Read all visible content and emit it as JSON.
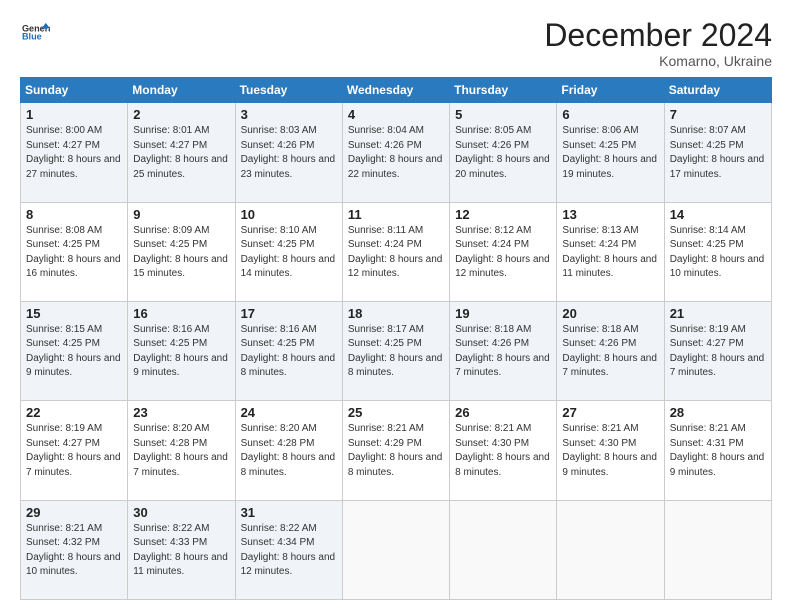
{
  "logo": {
    "line1": "General",
    "line2": "Blue"
  },
  "title": "December 2024",
  "location": "Komarno, Ukraine",
  "days_of_week": [
    "Sunday",
    "Monday",
    "Tuesday",
    "Wednesday",
    "Thursday",
    "Friday",
    "Saturday"
  ],
  "weeks": [
    [
      {
        "day": 1,
        "sunrise": "8:00 AM",
        "sunset": "4:27 PM",
        "daylight": "8 hours and 27 minutes."
      },
      {
        "day": 2,
        "sunrise": "8:01 AM",
        "sunset": "4:27 PM",
        "daylight": "8 hours and 25 minutes."
      },
      {
        "day": 3,
        "sunrise": "8:03 AM",
        "sunset": "4:26 PM",
        "daylight": "8 hours and 23 minutes."
      },
      {
        "day": 4,
        "sunrise": "8:04 AM",
        "sunset": "4:26 PM",
        "daylight": "8 hours and 22 minutes."
      },
      {
        "day": 5,
        "sunrise": "8:05 AM",
        "sunset": "4:26 PM",
        "daylight": "8 hours and 20 minutes."
      },
      {
        "day": 6,
        "sunrise": "8:06 AM",
        "sunset": "4:25 PM",
        "daylight": "8 hours and 19 minutes."
      },
      {
        "day": 7,
        "sunrise": "8:07 AM",
        "sunset": "4:25 PM",
        "daylight": "8 hours and 17 minutes."
      }
    ],
    [
      {
        "day": 8,
        "sunrise": "8:08 AM",
        "sunset": "4:25 PM",
        "daylight": "8 hours and 16 minutes."
      },
      {
        "day": 9,
        "sunrise": "8:09 AM",
        "sunset": "4:25 PM",
        "daylight": "8 hours and 15 minutes."
      },
      {
        "day": 10,
        "sunrise": "8:10 AM",
        "sunset": "4:25 PM",
        "daylight": "8 hours and 14 minutes."
      },
      {
        "day": 11,
        "sunrise": "8:11 AM",
        "sunset": "4:24 PM",
        "daylight": "8 hours and 12 minutes."
      },
      {
        "day": 12,
        "sunrise": "8:12 AM",
        "sunset": "4:24 PM",
        "daylight": "8 hours and 12 minutes."
      },
      {
        "day": 13,
        "sunrise": "8:13 AM",
        "sunset": "4:24 PM",
        "daylight": "8 hours and 11 minutes."
      },
      {
        "day": 14,
        "sunrise": "8:14 AM",
        "sunset": "4:25 PM",
        "daylight": "8 hours and 10 minutes."
      }
    ],
    [
      {
        "day": 15,
        "sunrise": "8:15 AM",
        "sunset": "4:25 PM",
        "daylight": "8 hours and 9 minutes."
      },
      {
        "day": 16,
        "sunrise": "8:16 AM",
        "sunset": "4:25 PM",
        "daylight": "8 hours and 9 minutes."
      },
      {
        "day": 17,
        "sunrise": "8:16 AM",
        "sunset": "4:25 PM",
        "daylight": "8 hours and 8 minutes."
      },
      {
        "day": 18,
        "sunrise": "8:17 AM",
        "sunset": "4:25 PM",
        "daylight": "8 hours and 8 minutes."
      },
      {
        "day": 19,
        "sunrise": "8:18 AM",
        "sunset": "4:26 PM",
        "daylight": "8 hours and 7 minutes."
      },
      {
        "day": 20,
        "sunrise": "8:18 AM",
        "sunset": "4:26 PM",
        "daylight": "8 hours and 7 minutes."
      },
      {
        "day": 21,
        "sunrise": "8:19 AM",
        "sunset": "4:27 PM",
        "daylight": "8 hours and 7 minutes."
      }
    ],
    [
      {
        "day": 22,
        "sunrise": "8:19 AM",
        "sunset": "4:27 PM",
        "daylight": "8 hours and 7 minutes."
      },
      {
        "day": 23,
        "sunrise": "8:20 AM",
        "sunset": "4:28 PM",
        "daylight": "8 hours and 7 minutes."
      },
      {
        "day": 24,
        "sunrise": "8:20 AM",
        "sunset": "4:28 PM",
        "daylight": "8 hours and 8 minutes."
      },
      {
        "day": 25,
        "sunrise": "8:21 AM",
        "sunset": "4:29 PM",
        "daylight": "8 hours and 8 minutes."
      },
      {
        "day": 26,
        "sunrise": "8:21 AM",
        "sunset": "4:30 PM",
        "daylight": "8 hours and 8 minutes."
      },
      {
        "day": 27,
        "sunrise": "8:21 AM",
        "sunset": "4:30 PM",
        "daylight": "8 hours and 9 minutes."
      },
      {
        "day": 28,
        "sunrise": "8:21 AM",
        "sunset": "4:31 PM",
        "daylight": "8 hours and 9 minutes."
      }
    ],
    [
      {
        "day": 29,
        "sunrise": "8:21 AM",
        "sunset": "4:32 PM",
        "daylight": "8 hours and 10 minutes."
      },
      {
        "day": 30,
        "sunrise": "8:22 AM",
        "sunset": "4:33 PM",
        "daylight": "8 hours and 11 minutes."
      },
      {
        "day": 31,
        "sunrise": "8:22 AM",
        "sunset": "4:34 PM",
        "daylight": "8 hours and 12 minutes."
      },
      null,
      null,
      null,
      null
    ]
  ],
  "labels": {
    "sunrise": "Sunrise:",
    "sunset": "Sunset:",
    "daylight": "Daylight:"
  }
}
